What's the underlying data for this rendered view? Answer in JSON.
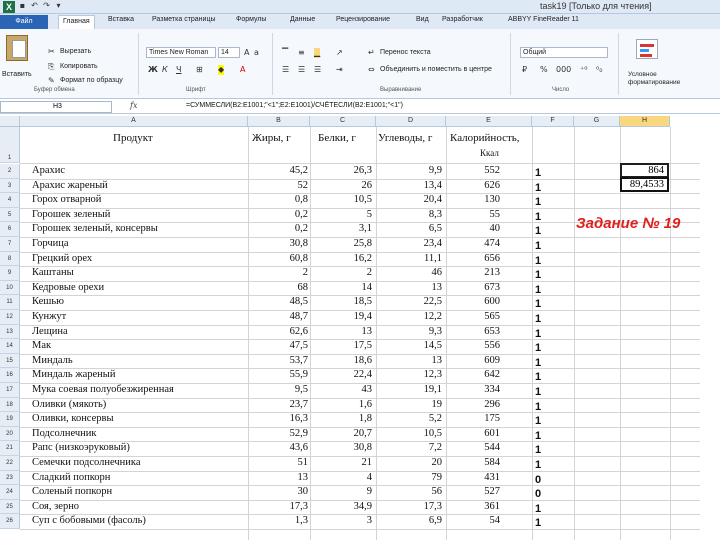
{
  "window": {
    "app_icon": "excel-icon",
    "title": "task19  [Только для чтения]"
  },
  "tabs": [
    "Файл",
    "Главная",
    "Вставка",
    "Разметка страницы",
    "Формулы",
    "Данные",
    "Рецензирование",
    "Вид",
    "Разработчик",
    "ABBYY FineReader 11"
  ],
  "ribbon": {
    "clipboard": {
      "paste": "Вставить",
      "cut": "Вырезать",
      "copy": "Копировать",
      "format_painter": "Формат по образцу",
      "group": "Буфер обмена"
    },
    "font": {
      "family": "Times New Roman",
      "size": "14",
      "group": "Шрифт"
    },
    "alignment": {
      "wrap": "Перенос текста",
      "merge": "Объединить и поместить в центре",
      "group": "Выравнивание"
    },
    "number": {
      "format": "Общий",
      "group": "Число"
    },
    "styles": {
      "conditional": "Условное форматирование"
    }
  },
  "formula_bar": {
    "name_box": "H3",
    "fx": "fx",
    "formula": "=СУММЕСЛИ(B2:E1001;\"<1\";E2:E1001)/СЧЁТЕСЛИ(B2:E1001;\"<1\")"
  },
  "columns": [
    "A",
    "B",
    "C",
    "D",
    "E",
    "F",
    "G",
    "H"
  ],
  "table": {
    "headers": [
      "Продукт",
      "Жиры, г",
      "Белки, г",
      "Углеводы, г",
      "Калорийность,",
      "Ккал"
    ],
    "rows": [
      [
        "Арахис",
        "45,2",
        "26,3",
        "9,9",
        "552",
        "1"
      ],
      [
        "Арахис жареный",
        "52",
        "26",
        "13,4",
        "626",
        "1"
      ],
      [
        "Горох отварной",
        "0,8",
        "10,5",
        "20,4",
        "130",
        "1"
      ],
      [
        "Горошек зеленый",
        "0,2",
        "5",
        "8,3",
        "55",
        "1"
      ],
      [
        "Горошек зеленый, консервы",
        "0,2",
        "3,1",
        "6,5",
        "40",
        "1"
      ],
      [
        "Горчица",
        "30,8",
        "25,8",
        "23,4",
        "474",
        "1"
      ],
      [
        "Грецкий орех",
        "60,8",
        "16,2",
        "11,1",
        "656",
        "1"
      ],
      [
        "Каштаны",
        "2",
        "2",
        "46",
        "213",
        "1"
      ],
      [
        "Кедровые орехи",
        "68",
        "14",
        "13",
        "673",
        "1"
      ],
      [
        "Кешью",
        "48,5",
        "18,5",
        "22,5",
        "600",
        "1"
      ],
      [
        "Кунжут",
        "48,7",
        "19,4",
        "12,2",
        "565",
        "1"
      ],
      [
        "Лещина",
        "62,6",
        "13",
        "9,3",
        "653",
        "1"
      ],
      [
        "Мак",
        "47,5",
        "17,5",
        "14,5",
        "556",
        "1"
      ],
      [
        "Миндаль",
        "53,7",
        "18,6",
        "13",
        "609",
        "1"
      ],
      [
        "Миндаль жареный",
        "55,9",
        "22,4",
        "12,3",
        "642",
        "1"
      ],
      [
        "Мука соевая полуобезжиренная",
        "9,5",
        "43",
        "19,1",
        "334",
        "1"
      ],
      [
        "Оливки (мякоть)",
        "23,7",
        "1,6",
        "19",
        "296",
        "1"
      ],
      [
        "Оливки, консервы",
        "16,3",
        "1,8",
        "5,2",
        "175",
        "1"
      ],
      [
        "Подсолнечник",
        "52,9",
        "20,7",
        "10,5",
        "601",
        "1"
      ],
      [
        "Рапс (низкоэруковый)",
        "43,6",
        "30,8",
        "7,2",
        "544",
        "1"
      ],
      [
        "Семечки подсолнечника",
        "51",
        "21",
        "20",
        "584",
        "1"
      ],
      [
        "Сладкий попкорн",
        "13",
        "4",
        "79",
        "431",
        "0"
      ],
      [
        "Соленый попкорн",
        "30",
        "9",
        "56",
        "527",
        "0"
      ],
      [
        "Соя, зерно",
        "17,3",
        "34,9",
        "17,3",
        "361",
        "1"
      ],
      [
        "Суп с бобовыми (фасоль)",
        "1,3",
        "3",
        "6,9",
        "54",
        "1"
      ]
    ]
  },
  "results": {
    "h2": "864",
    "h3": "89,4533"
  },
  "annotation": "Задание № 19"
}
